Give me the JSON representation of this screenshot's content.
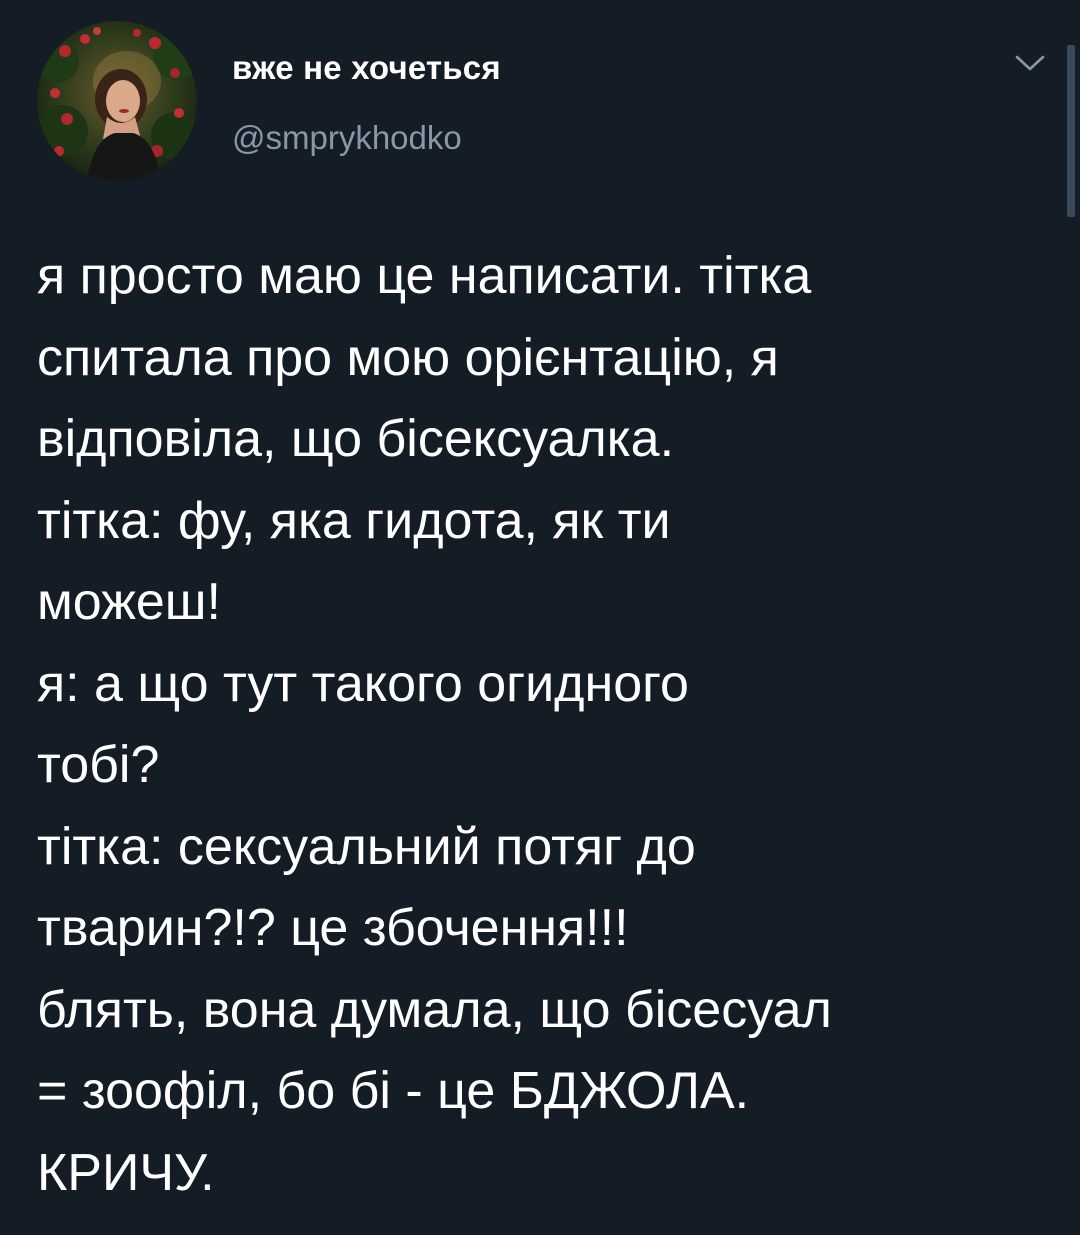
{
  "header": {
    "display_name": "вже не хочеться",
    "handle": "@smprykhodko",
    "avatar_icon": "profile-photo",
    "menu_icon": "chevron-down-icon"
  },
  "tweet": {
    "lines": [
      "я просто маю це написати. тітка",
      "спитала про мою орієнтацію, я",
      "відповіла, що бісексуалка.",
      "тітка: фу, яка гидота, як ти",
      "можеш!",
      "я: а що тут такого огидного",
      "тобі?",
      "тітка: сексуальний потяг до",
      "тварин?!? це збочення!!!",
      "блять, вона думала, що бісесуал",
      "= зоофіл, бо бі - це БДЖОЛА.",
      "КРИЧУ."
    ]
  },
  "colors": {
    "background": "#141d26",
    "primary_text": "#ffffff",
    "secondary_text": "#8899a6"
  }
}
